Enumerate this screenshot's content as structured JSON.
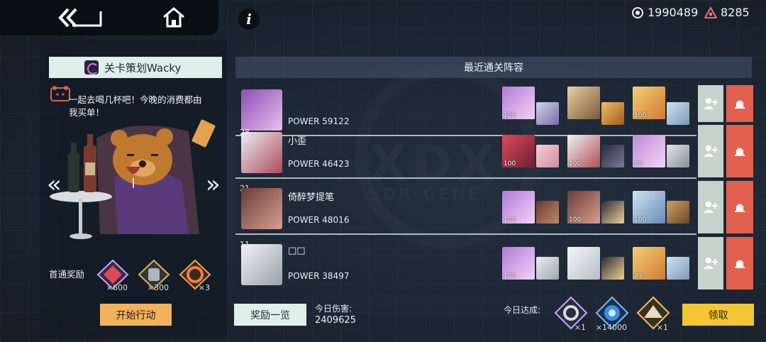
{
  "currency": {
    "gems": "1990489",
    "tokens": "8285",
    "gems_icon": "target-coin-icon",
    "tokens_icon": "triangle-crystal-icon"
  },
  "nav": {
    "back_icon": "back-arrow-icon",
    "home_icon": "home-icon",
    "info_label": "i"
  },
  "stage": {
    "title": "关卡策划Wacky",
    "speech": "一起去喝几杯吧！今晚的消费都由我买单！",
    "first_clear_label": "首通奖励",
    "rewards": [
      {
        "icon": "red-crystal-icon",
        "qty": "×600"
      },
      {
        "icon": "screw-part-icon",
        "qty": "×300"
      },
      {
        "icon": "flame-ring-icon",
        "qty": "×3"
      }
    ],
    "start_label": "开始行动"
  },
  "recent": {
    "header": "最近通关阵容",
    "rows": [
      {
        "rank": "",
        "name": "",
        "power": "POWER 59122",
        "badges": [
          "100",
          "",
          "",
          "",
          "100",
          ""
        ]
      },
      {
        "rank": "28",
        "name": "小歪",
        "power": "POWER 46423",
        "badges": [
          "100",
          "",
          "100",
          "",
          "98",
          ""
        ]
      },
      {
        "rank": "21",
        "name": "倚醉梦提笔",
        "power": "POWER 48016",
        "badges": [
          "100",
          "",
          "100",
          "",
          "100",
          ""
        ]
      },
      {
        "rank": "11",
        "name": "□□",
        "power": "POWER 38497",
        "badges": [
          "100",
          "",
          "",
          "",
          "99",
          ""
        ]
      }
    ]
  },
  "bottom": {
    "rewards_list_label": "奖励一览",
    "today_damage_label": "今日伤害:",
    "today_damage_value": "2409625",
    "today_achieve_label": "今日达成:",
    "achievements": [
      {
        "icon": "mech-part-icon",
        "qty": "×1"
      },
      {
        "icon": "blue-orb-icon",
        "qty": "×14000"
      },
      {
        "icon": "tent-icon",
        "qty": "×1"
      }
    ],
    "claim_label": "领取"
  },
  "colors": {
    "claim": "#f3c633",
    "start": "#f4b15c",
    "alert": "#e2604e",
    "add": "#c6d3cd"
  }
}
